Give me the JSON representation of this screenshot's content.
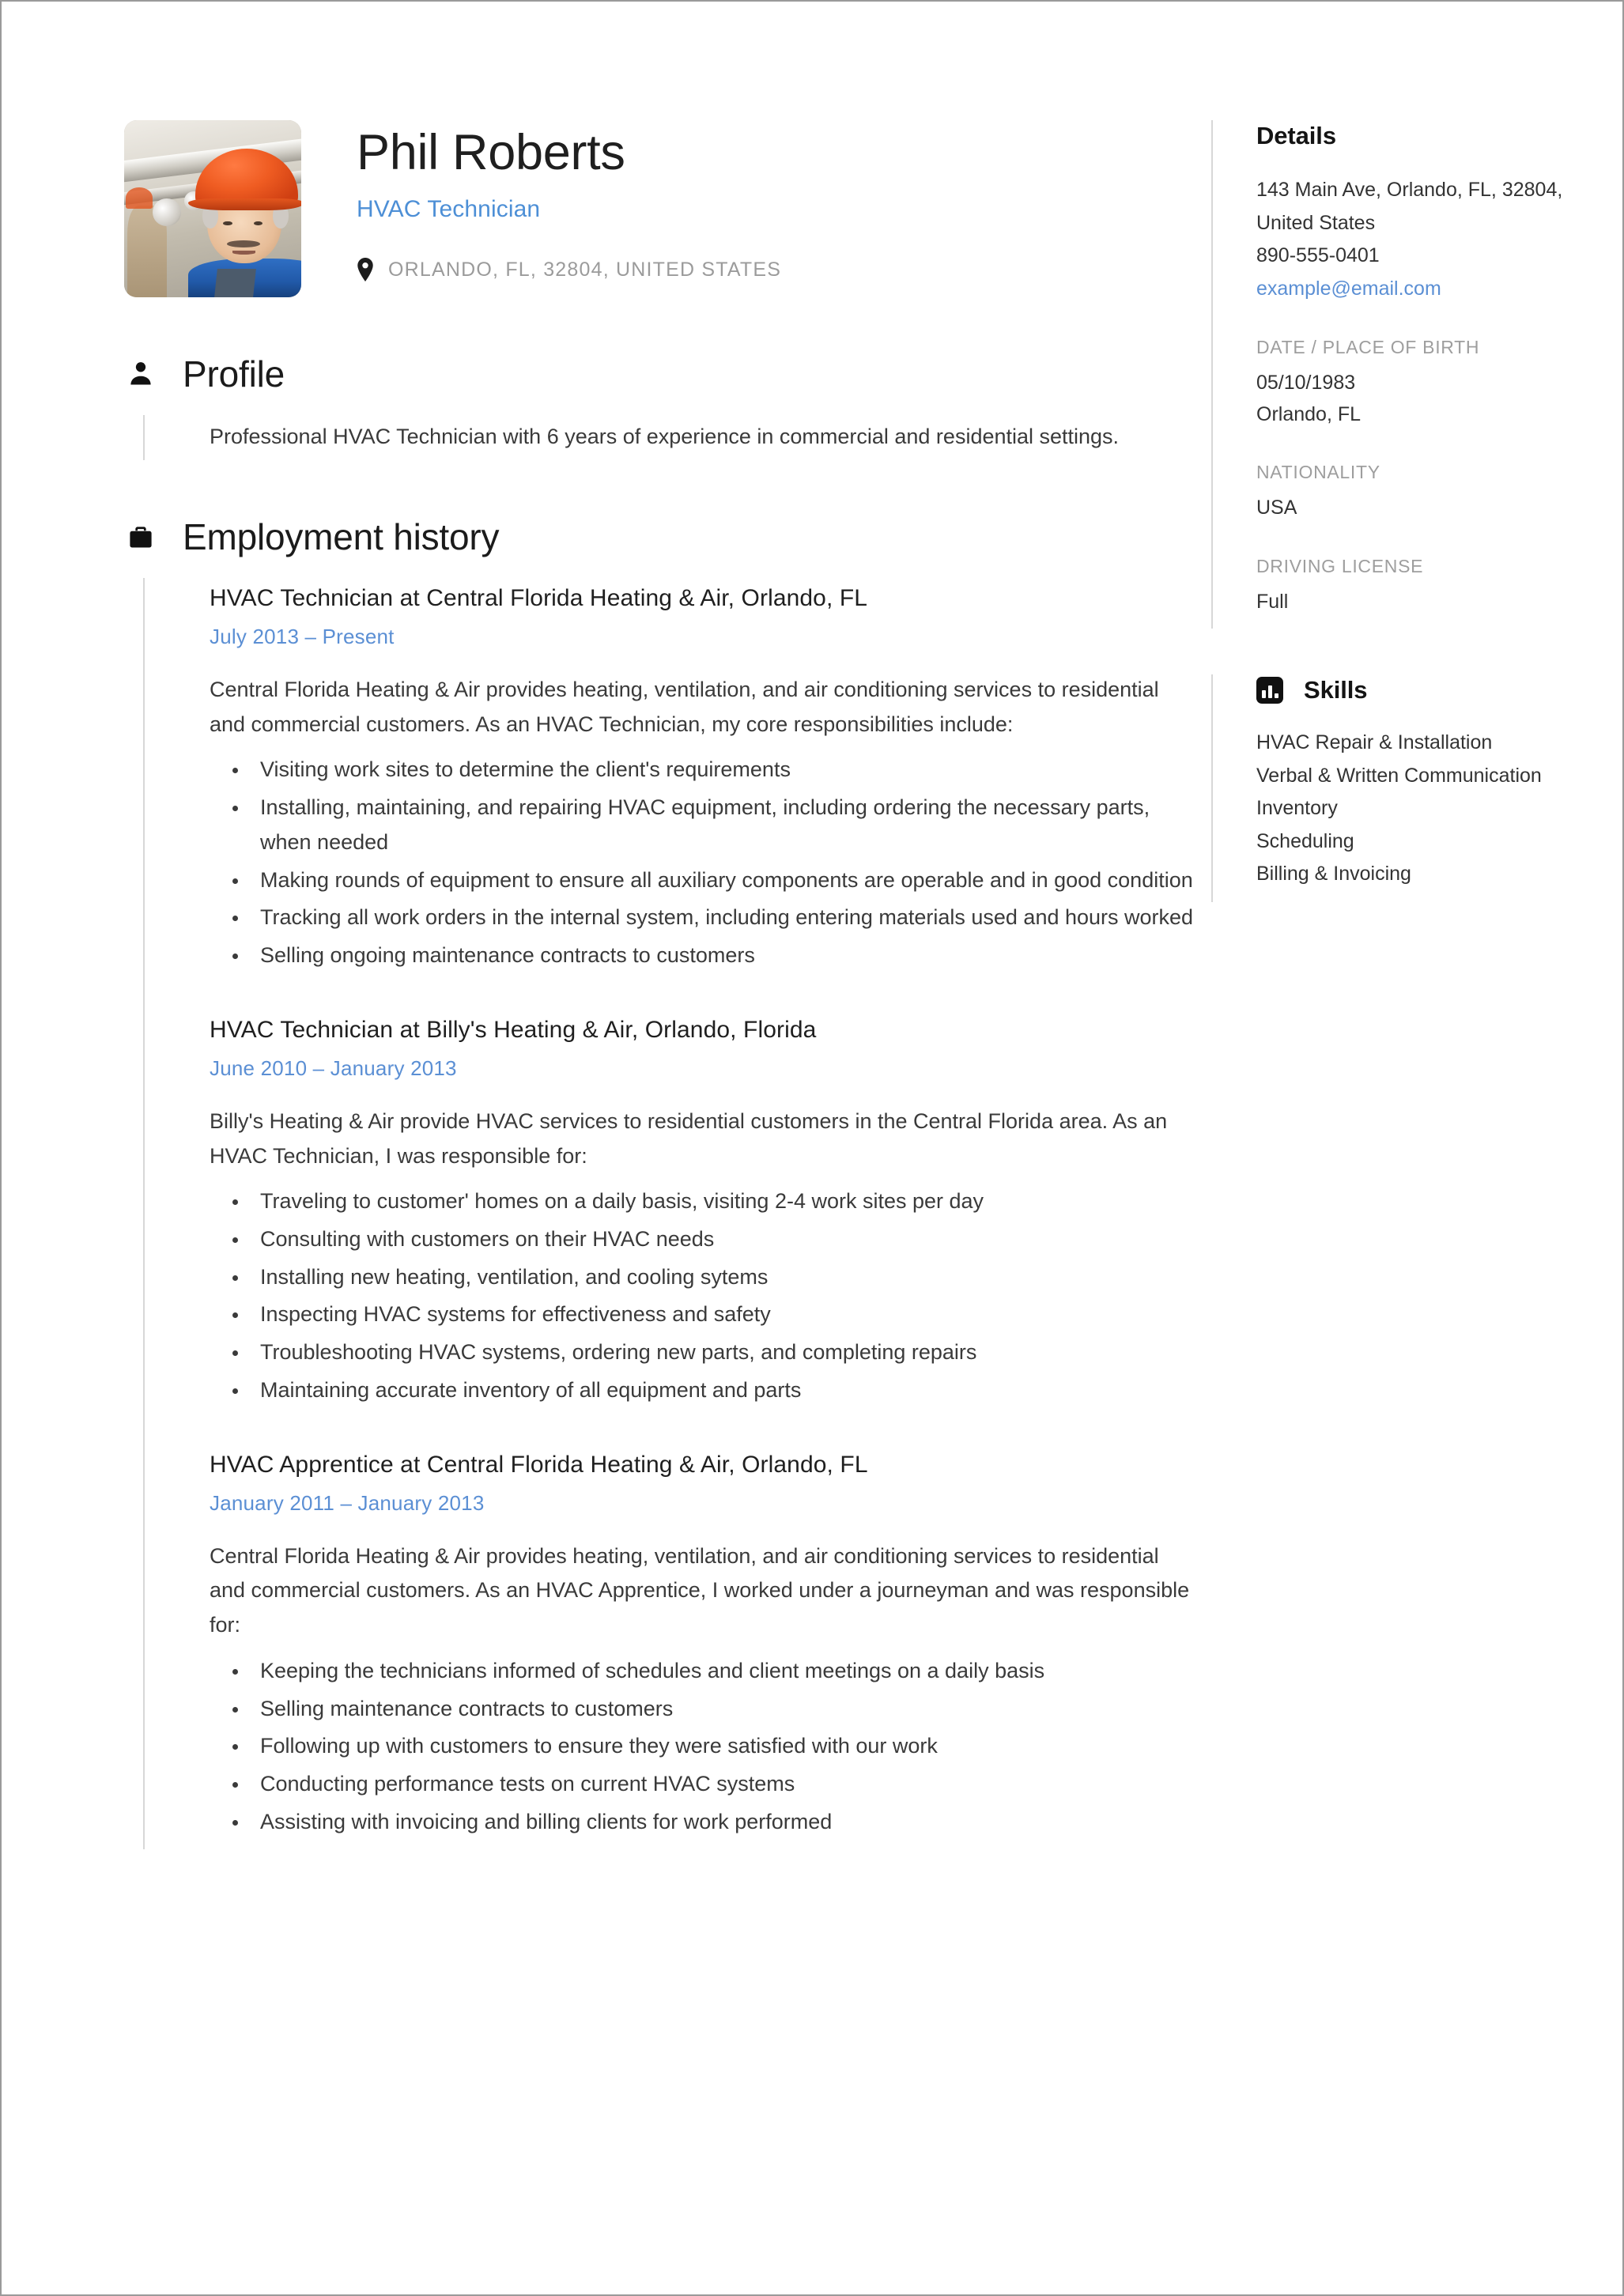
{
  "header": {
    "name": "Phil Roberts",
    "job_title": "HVAC Technician",
    "location": "ORLANDO, FL, 32804, UNITED STATES",
    "photo_alt": "profile-photo"
  },
  "profile": {
    "section_title": "Profile",
    "icon": "person-icon",
    "text": "Professional HVAC Technician with 6 years of experience in commercial and residential settings."
  },
  "employment": {
    "section_title": "Employment history",
    "icon": "briefcase-icon",
    "jobs": [
      {
        "title": "HVAC Technician at Central Florida Heating & Air, Orlando, FL",
        "dates": "July 2013  –  Present",
        "description": "Central Florida Heating & Air provides heating, ventilation, and air conditioning services to residential and commercial customers. As an HVAC Technician, my core responsibilities include:",
        "bullets": [
          "Visiting work sites to determine the client's requirements",
          "Installing, maintaining, and repairing HVAC equipment, including ordering the necessary parts, when needed",
          "Making rounds of equipment to ensure all auxiliary components are operable and in good condition",
          "Tracking all work orders in the internal system, including entering materials used and hours worked",
          "Selling ongoing maintenance contracts to customers"
        ]
      },
      {
        "title": "HVAC Technician at Billy's Heating & Air, Orlando, Florida",
        "dates": "June 2010  –  January 2013",
        "description": "Billy's Heating & Air provide HVAC services to residential customers in the Central Florida area. As an HVAC Technician, I was responsible for:",
        "bullets": [
          "Traveling to customer' homes on a daily basis, visiting 2-4 work sites per day",
          "Consulting with customers on their HVAC needs",
          "Installing new heating, ventilation, and cooling sytems",
          "Inspecting HVAC systems for effectiveness and safety",
          "Troubleshooting HVAC systems, ordering new parts, and completing repairs",
          "Maintaining accurate inventory of all equipment and parts"
        ]
      },
      {
        "title": "HVAC Apprentice at Central Florida Heating & Air, Orlando, FL",
        "dates": "January 2011  –  January 2013",
        "description": "Central Florida Heating & Air provides heating, ventilation, and air conditioning services to residential and commercial customers. As an HVAC Apprentice, I worked under a journeyman and was responsible for:",
        "bullets": [
          "Keeping the technicians informed of schedules and client meetings on a daily basis",
          "Selling maintenance contracts to customers",
          "Following up with customers to ensure they were satisfied with our work",
          "Conducting performance tests on current HVAC systems",
          "Assisting with invoicing and billing clients for work performed"
        ]
      }
    ]
  },
  "details": {
    "section_title": "Details",
    "address": "143 Main Ave, Orlando, FL, 32804, United States",
    "phone": "890-555-0401",
    "email": "example@email.com",
    "dob_label": "DATE / PLACE OF BIRTH",
    "dob_value": "05/10/1983",
    "birth_place": "Orlando, FL",
    "nationality_label": "NATIONALITY",
    "nationality_value": "USA",
    "license_label": "DRIVING LICENSE",
    "license_value": "Full"
  },
  "skills": {
    "section_title": "Skills",
    "icon": "bar-chart-icon",
    "items": [
      "HVAC Repair & Installation",
      "Verbal & Written Communication",
      "Inventory",
      "Scheduling",
      "Billing & Invoicing"
    ]
  },
  "colors": {
    "accent_blue": "#5b8fd4",
    "link_blue": "#4d8fd6",
    "muted_gray": "#9e9e9e",
    "rule_gray": "#d7d7d7",
    "text": "#3a3a3a"
  }
}
